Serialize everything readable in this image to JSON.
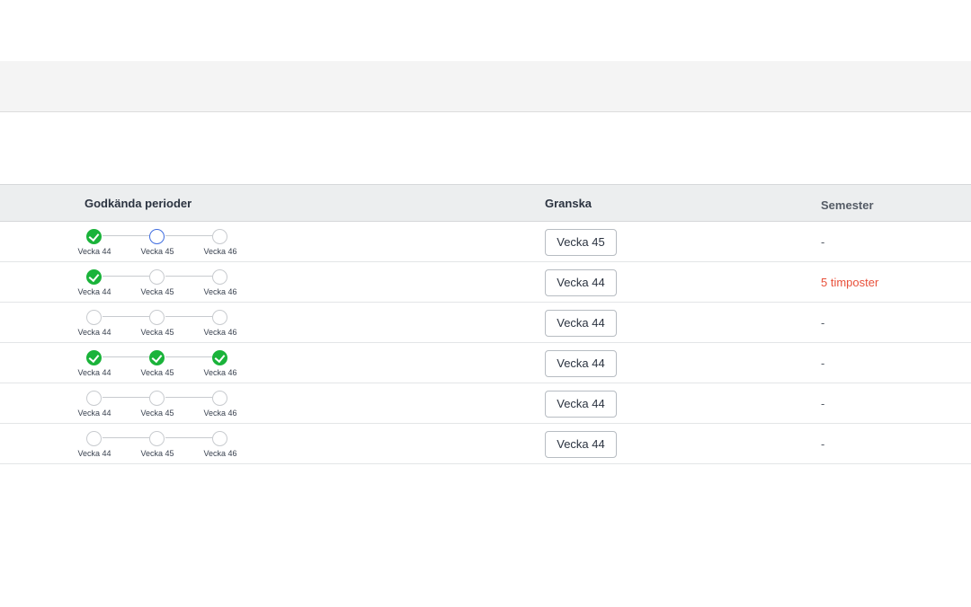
{
  "colors": {
    "done": "#1ab33a",
    "active": "#3f6de0",
    "pending": "#c8cbcf",
    "alert": "#e8503a"
  },
  "table": {
    "headers": {
      "periods": "Godkända perioder",
      "review": "Granska",
      "vacation": "Semester"
    },
    "period_labels": [
      "Vecka 44",
      "Vecka 45",
      "Vecka 46"
    ],
    "rows": [
      {
        "steps": [
          "done",
          "active",
          "pending"
        ],
        "review": "Vecka 45",
        "vacation": "-",
        "vacation_alert": false
      },
      {
        "steps": [
          "done",
          "pending",
          "pending"
        ],
        "review": "Vecka 44",
        "vacation": "5 timposter",
        "vacation_alert": true
      },
      {
        "steps": [
          "pending",
          "pending",
          "pending"
        ],
        "review": "Vecka 44",
        "vacation": "-",
        "vacation_alert": false
      },
      {
        "steps": [
          "done",
          "done",
          "done"
        ],
        "review": "Vecka 44",
        "vacation": "-",
        "vacation_alert": false
      },
      {
        "steps": [
          "pending",
          "pending",
          "pending"
        ],
        "review": "Vecka 44",
        "vacation": "-",
        "vacation_alert": false
      },
      {
        "steps": [
          "pending",
          "pending",
          "pending"
        ],
        "review": "Vecka 44",
        "vacation": "-",
        "vacation_alert": false
      }
    ]
  }
}
